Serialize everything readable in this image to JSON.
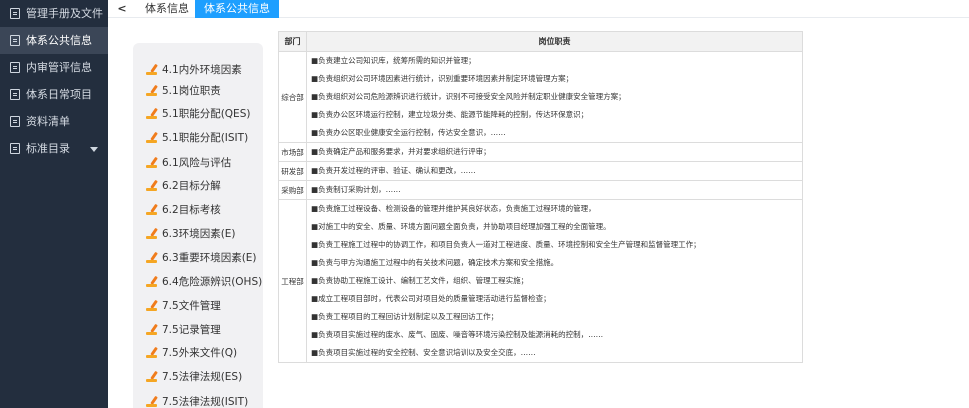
{
  "sidebar": {
    "items": [
      {
        "label": "管理手册及文件",
        "active": false,
        "arrow": false
      },
      {
        "label": "体系公共信息",
        "active": true,
        "arrow": false
      },
      {
        "label": "内审管评信息",
        "active": false,
        "arrow": false
      },
      {
        "label": "体系日常项目",
        "active": false,
        "arrow": false
      },
      {
        "label": "资料清单",
        "active": false,
        "arrow": false
      },
      {
        "label": "标准目录",
        "active": false,
        "arrow": true
      }
    ]
  },
  "tabs": {
    "back": "<",
    "items": [
      {
        "label": "体系信息",
        "active": false
      },
      {
        "label": "体系公共信息",
        "active": true
      }
    ]
  },
  "tree": {
    "items": [
      "4.1内外环境因素",
      "5.1岗位职责",
      "5.1职能分配(QES)",
      "5.1职能分配(ISIT)",
      "6.1风险与评估",
      "6.2目标分解",
      "6.2目标考核",
      "6.3环境因素(E)",
      "6.3重要环境因素(E)",
      "6.4危险源辨识(OHS)",
      "7.5文件管理",
      "7.5记录管理",
      "7.5外来文件(Q)",
      "7.5法律法规(ES)",
      "7.5法律法规(ISIT)"
    ]
  },
  "table": {
    "headers": [
      "部门",
      "岗位职责"
    ],
    "rows": [
      {
        "dept": "综合部",
        "duties": [
          "■负责建立公司知识库，统筹所需的知识并管理；",
          "■负责组织对公司环境因素进行统计，识别重要环境因素并制定环境管理方案；",
          "■负责组织对公司危险源辨识进行统计，识别不可接受安全风险并制定职业健康安全管理方案；",
          "■负责办公区环境运行控制，建立垃圾分类、能源节能降耗的控制，传达环保意识；",
          "■负责办公区职业健康安全运行控制，传达安全意识，……"
        ]
      },
      {
        "dept": "市场部",
        "duties": [
          "■负责确定产品和服务要求，并对要求组织进行评审；"
        ]
      },
      {
        "dept": "研发部",
        "duties": [
          "■负责开发过程的评审、验证、确认和更改，……"
        ]
      },
      {
        "dept": "采购部",
        "duties": [
          "■负责制订采购计划，……"
        ]
      },
      {
        "dept": "工程部",
        "duties": [
          "■负责施工过程设备、检测设备的管理并维护其良好状态，负责施工过程环境的管理，",
          "■对施工中的安全、质量、环境方面问题全面负责，并协助项目经理加强工程的全面管理。",
          "■负责工程施工过程中的协调工作，和项目负责人一道对工程进度、质量、环境控制和安全生产管理和监督管理工作；",
          "■负责与甲方沟通施工过程中的有关技术问题，确定技术方案和安全措施。",
          "■负责协助工程施工设计、编制工艺文件，组织、管理工程实施；",
          "■成立工程项目部时，代表公司对项目处的质量管理活动进行监督检查；",
          "■负责工程项目的工程回访计划制定以及工程回访工作；",
          "■负责项目实施过程的废水、废气、固废、噪音等环境污染控制及能源消耗的控制，……",
          "■负责项目实施过程的安全控制、安全意识培训以及安全交底，……"
        ]
      }
    ]
  }
}
